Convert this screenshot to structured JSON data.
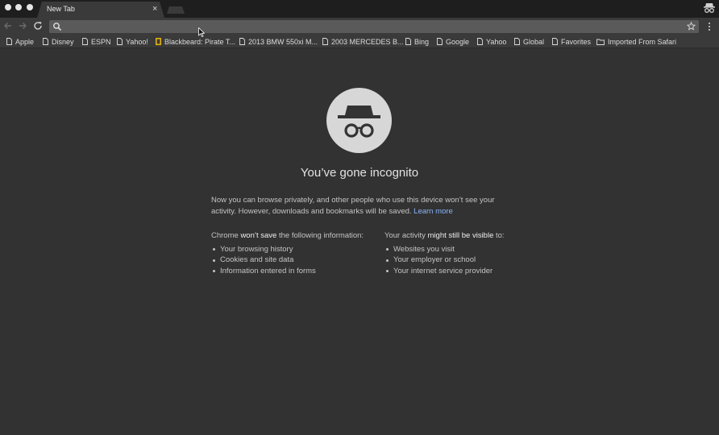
{
  "window": {
    "tab_title": "New Tab",
    "tab_close": "×",
    "incognito_badge_icon": "incognito-icon"
  },
  "toolbar": {
    "back_icon": "back-arrow-icon",
    "forward_icon": "forward-arrow-icon",
    "reload_icon": "reload-icon",
    "omnibox_value": "",
    "bookmark_star_icon": "star-icon",
    "menu_icon": "vertical-dots-icon"
  },
  "bookmarks": [
    {
      "label": "Apple",
      "icon": "page-icon"
    },
    {
      "label": "Disney",
      "icon": "page-icon"
    },
    {
      "label": "ESPN",
      "icon": "page-icon"
    },
    {
      "label": "Yahoo!",
      "icon": "page-icon"
    },
    {
      "label": "Blackbeard: Pirate T...",
      "icon": "national-geographic-icon"
    },
    {
      "label": "2013 BMW 550xi M...",
      "icon": "page-icon"
    },
    {
      "label": "2003 MERCEDES B...",
      "icon": "page-icon"
    },
    {
      "label": "Bing",
      "icon": "page-icon"
    },
    {
      "label": "Google",
      "icon": "page-icon"
    },
    {
      "label": "Yahoo",
      "icon": "page-icon"
    },
    {
      "label": "Global",
      "icon": "page-icon"
    },
    {
      "label": "Favorites",
      "icon": "page-icon"
    },
    {
      "label": "Imported From Safari",
      "icon": "folder-icon"
    }
  ],
  "incognito": {
    "heading": "You’ve gone incognito",
    "intro": "Now you can browse privately, and other people who use this device won’t see your activity. However, downloads and bookmarks will be saved.",
    "learn_more": "Learn more",
    "left_column": {
      "head_before": "Chrome ",
      "head_bold": "won’t save",
      "head_after": " the following information:",
      "items": [
        "Your browsing history",
        "Cookies and site data",
        "Information entered in forms"
      ]
    },
    "right_column": {
      "head_before": "Your activity ",
      "head_bold": "might still be visible",
      "head_after": " to:",
      "items": [
        "Websites you visit",
        "Your employer or school",
        "Your internet service provider"
      ]
    }
  },
  "colors": {
    "page_background": "#323232",
    "toolbar": "#3a3a3a",
    "link": "#8ab4f8"
  }
}
